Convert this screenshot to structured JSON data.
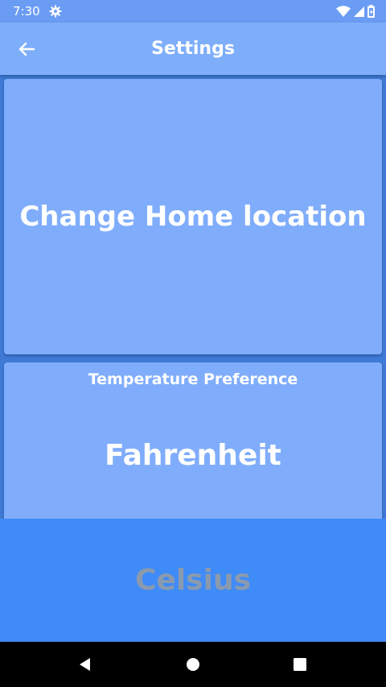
{
  "status_bar": {
    "time": "7:30",
    "icons": [
      "gear-icon",
      "wifi-icon",
      "cell-signal-icon",
      "battery-icon"
    ]
  },
  "app_bar": {
    "title": "Settings",
    "back_icon": "arrow-left-icon"
  },
  "home_card": {
    "label": "Change Home location"
  },
  "temperature": {
    "title": "Temperature Preference",
    "options": [
      "Fahrenheit",
      "Celsius"
    ]
  },
  "nav_bar": {
    "icons": [
      "back-triangle-icon",
      "home-circle-icon",
      "recents-square-icon"
    ]
  },
  "colors": {
    "status_bar": "#6a9cf4",
    "app_bar": "#7eaefa",
    "card": "#80adfb",
    "background": "#3e7ad6",
    "celsius_area": "#3f8bf7",
    "celsius_text": "#8a9aae"
  }
}
